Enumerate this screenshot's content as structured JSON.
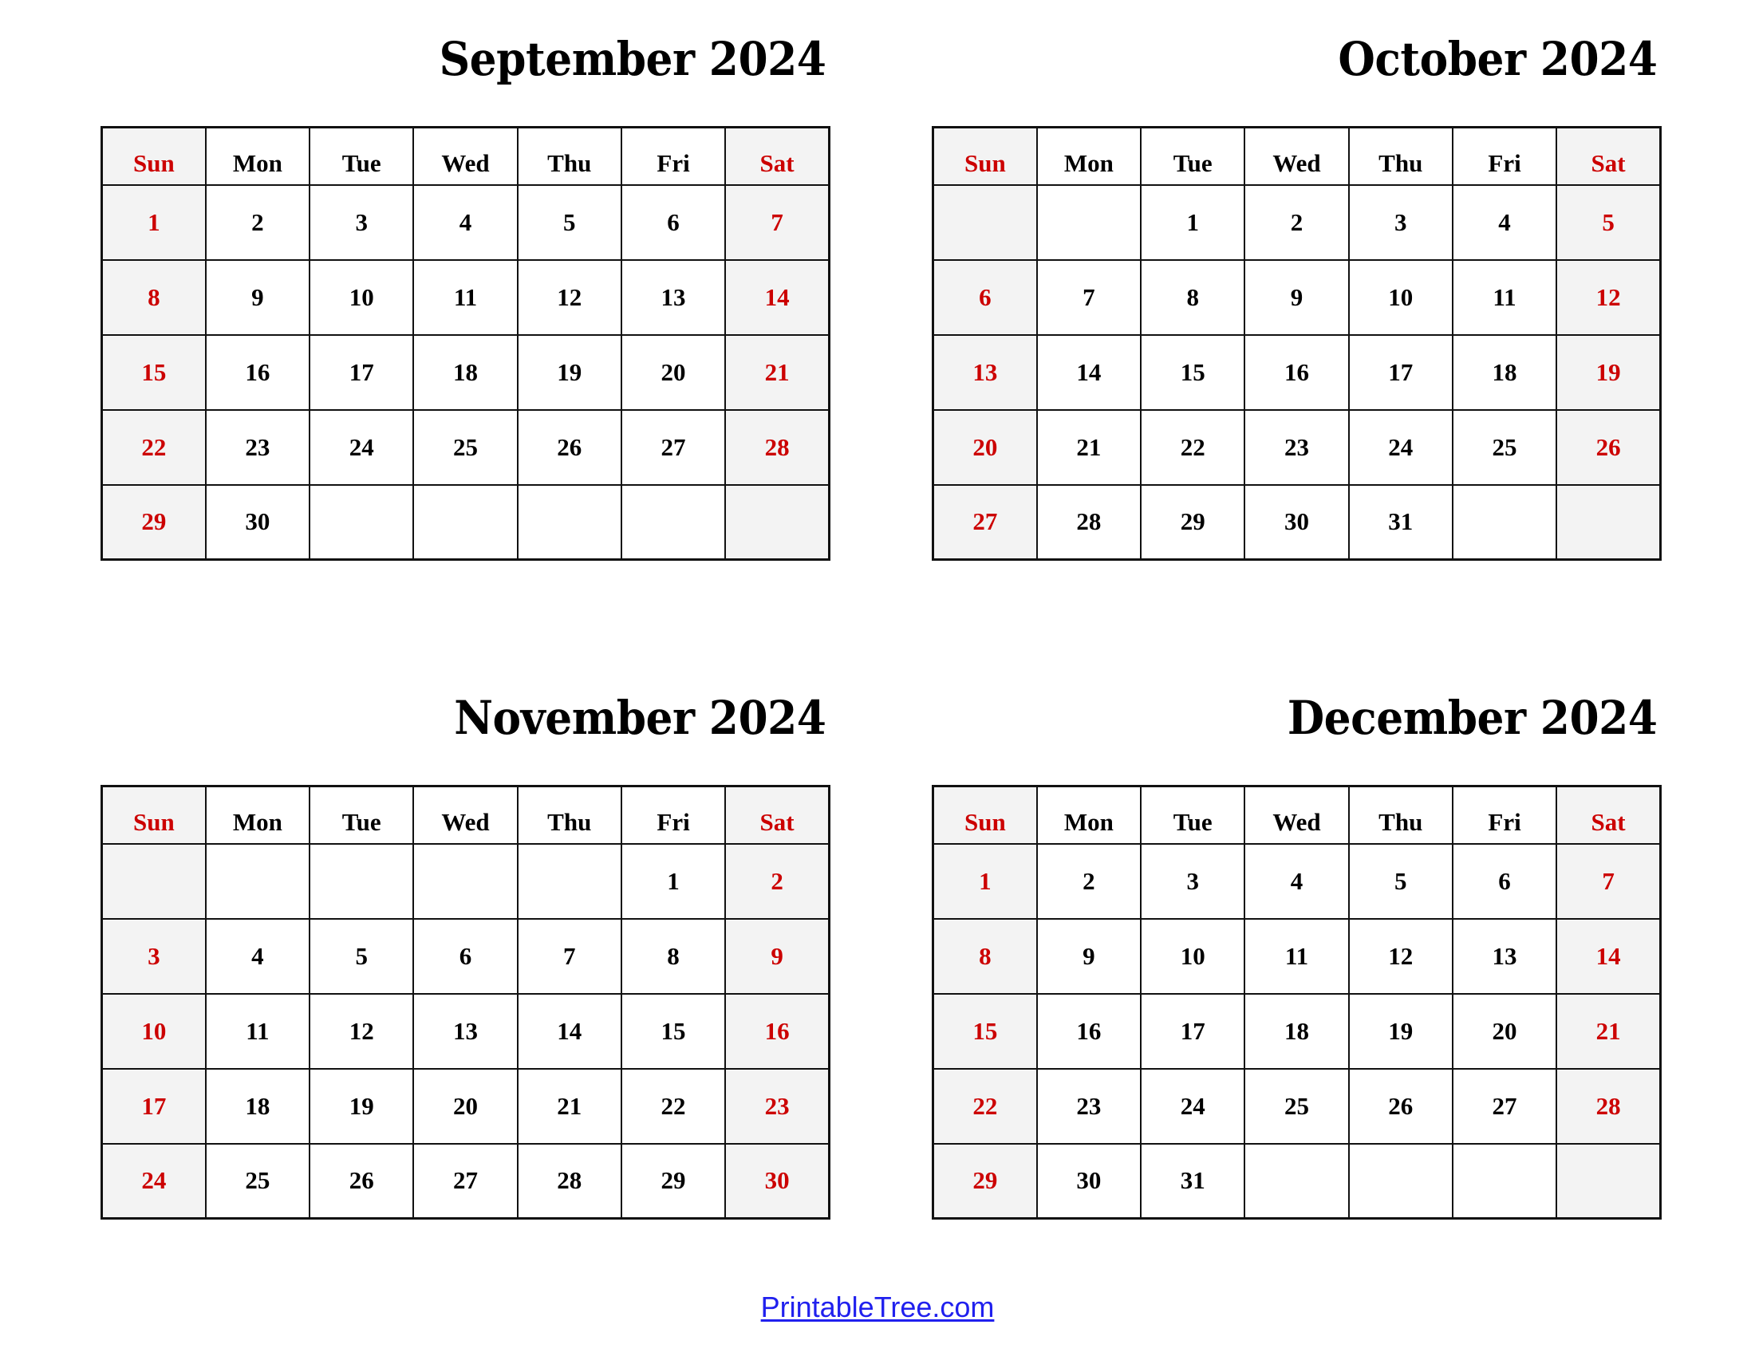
{
  "theme": {
    "page_background": "#ffffff",
    "text_color": "#000000",
    "weekend_color": "#cc0000",
    "weekend_cell_background": "#f3f3f3",
    "border_color": "#111111",
    "link_color": "#2020ee"
  },
  "weekday_headers": [
    "Sun",
    "Mon",
    "Tue",
    "Wed",
    "Thu",
    "Fri",
    "Sat"
  ],
  "weekend_indices": [
    0,
    6
  ],
  "footer": {
    "link_label": "PrintableTree.com"
  },
  "months": [
    {
      "key": "september",
      "title": "September 2024",
      "name": "September",
      "year": "2024",
      "first_weekday": "Sun",
      "days_in_month": 30,
      "weeks": [
        [
          "1",
          "2",
          "3",
          "4",
          "5",
          "6",
          "7"
        ],
        [
          "8",
          "9",
          "10",
          "11",
          "12",
          "13",
          "14"
        ],
        [
          "15",
          "16",
          "17",
          "18",
          "19",
          "20",
          "21"
        ],
        [
          "22",
          "23",
          "24",
          "25",
          "26",
          "27",
          "28"
        ],
        [
          "29",
          "30",
          "",
          "",
          "",
          "",
          ""
        ]
      ]
    },
    {
      "key": "october",
      "title": "October 2024",
      "name": "October",
      "year": "2024",
      "first_weekday": "Tue",
      "days_in_month": 31,
      "weeks": [
        [
          "",
          "",
          "1",
          "2",
          "3",
          "4",
          "5"
        ],
        [
          "6",
          "7",
          "8",
          "9",
          "10",
          "11",
          "12"
        ],
        [
          "13",
          "14",
          "15",
          "16",
          "17",
          "18",
          "19"
        ],
        [
          "20",
          "21",
          "22",
          "23",
          "24",
          "25",
          "26"
        ],
        [
          "27",
          "28",
          "29",
          "30",
          "31",
          "",
          ""
        ]
      ]
    },
    {
      "key": "november",
      "title": "November 2024",
      "name": "November",
      "year": "2024",
      "first_weekday": "Fri",
      "days_in_month": 30,
      "weeks": [
        [
          "",
          "",
          "",
          "",
          "",
          "1",
          "2"
        ],
        [
          "3",
          "4",
          "5",
          "6",
          "7",
          "8",
          "9"
        ],
        [
          "10",
          "11",
          "12",
          "13",
          "14",
          "15",
          "16"
        ],
        [
          "17",
          "18",
          "19",
          "20",
          "21",
          "22",
          "23"
        ],
        [
          "24",
          "25",
          "26",
          "27",
          "28",
          "29",
          "30"
        ]
      ]
    },
    {
      "key": "december",
      "title": "December 2024",
      "name": "December",
      "year": "2024",
      "first_weekday": "Sun",
      "days_in_month": 31,
      "weeks": [
        [
          "1",
          "2",
          "3",
          "4",
          "5",
          "6",
          "7"
        ],
        [
          "8",
          "9",
          "10",
          "11",
          "12",
          "13",
          "14"
        ],
        [
          "15",
          "16",
          "17",
          "18",
          "19",
          "20",
          "21"
        ],
        [
          "22",
          "23",
          "24",
          "25",
          "26",
          "27",
          "28"
        ],
        [
          "29",
          "30",
          "31",
          "",
          "",
          "",
          ""
        ]
      ]
    }
  ]
}
